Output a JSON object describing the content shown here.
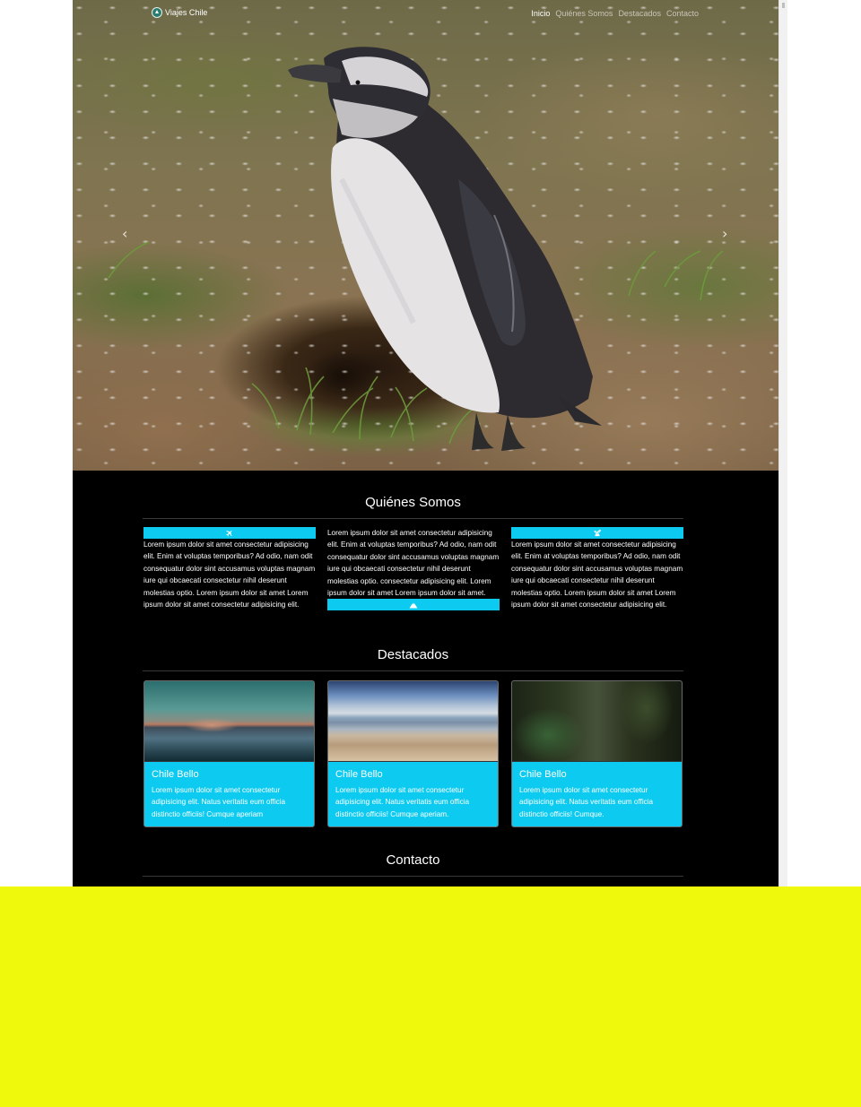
{
  "nav": {
    "brand": "Viajes Chile",
    "links": [
      {
        "label": "Inicio",
        "active": true
      },
      {
        "label": "Quiénes Somos",
        "active": false
      },
      {
        "label": "Destacados",
        "active": false
      },
      {
        "label": "Contacto",
        "active": false
      }
    ]
  },
  "hero": {
    "prev_glyph": "‹",
    "next_glyph": "›"
  },
  "about": {
    "title": "Quiénes Somos",
    "columns": [
      {
        "icon": "airplane-icon",
        "text": "Lorem ipsum dolor sit amet consectetur adipisicing elit. Enim at voluptas temporibus? Ad odio, nam odit consequatur dolor sint accusamus voluptas magnam iure qui obcaecati consectetur nihil deserunt molestias optio. Lorem ipsum dolor sit amet Lorem ipsum dolor sit amet consectetur adipisicing elit."
      },
      {
        "icon": "mountain-icon",
        "text": "Lorem ipsum dolor sit amet consectetur adipisicing elit. Enim at voluptas temporibus? Ad odio, nam odit consequatur dolor sint accusamus voluptas magnam iure qui obcaecati consectetur nihil deserunt molestias optio. consectetur adipisicing elit. Lorem ipsum dolor sit amet Lorem ipsum dolor sit amet."
      },
      {
        "icon": "plant-icon",
        "text": "Lorem ipsum dolor sit amet consectetur adipisicing elit. Enim at voluptas temporibus? Ad odio, nam odit consequatur dolor sint accusamus voluptas magnam iure qui obcaecati consectetur nihil deserunt molestias optio. Lorem ipsum dolor sit amet Lorem ipsum dolor sit amet consectetur adipisicing elit."
      }
    ]
  },
  "featured": {
    "title": "Destacados",
    "cards": [
      {
        "title": "Chile Bello",
        "text": "Lorem ipsum dolor sit amet consectetur adipisicing elit. Natus veritatis eum officia distinctio officiis! Cumque aperiam"
      },
      {
        "title": "Chile Bello",
        "text": "Lorem ipsum dolor sit amet consectetur adipisicing elit. Natus veritatis eum officia distinctio officiis! Cumque aperiam."
      },
      {
        "title": "Chile Bello",
        "text": "Lorem ipsum dolor sit amet consectetur adipisicing elit. Natus veritatis eum officia distinctio officiis! Cumque."
      }
    ]
  },
  "contact": {
    "title": "Contacto"
  },
  "colors": {
    "accent": "#0dcaf0",
    "background": "#000000",
    "overlay": "#eff90c"
  }
}
